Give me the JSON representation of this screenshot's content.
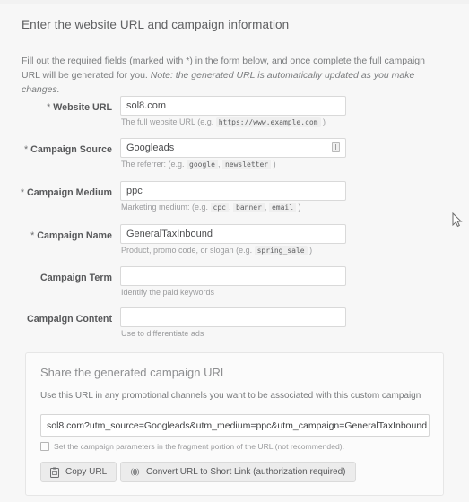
{
  "panel": {
    "heading": "Enter the website URL and campaign information",
    "intro_before": "Fill out the required fields (marked with *) in the form below, and once complete the full campaign URL will be generated for you. ",
    "intro_italic": "Note: the generated URL is automatically updated as you make changes."
  },
  "form": {
    "required_marker": "*",
    "fields": [
      {
        "label": "Website URL",
        "required": true,
        "value": "sol8.com",
        "placeholder": "",
        "hint_before": "The full website URL (e.g. ",
        "hint_code": "https://www.example.com",
        "hint_after": " )",
        "icon": ""
      },
      {
        "label": "Campaign Source",
        "required": true,
        "value": "Googleads",
        "placeholder": "",
        "hint_before": "The referrer: (e.g. ",
        "hint_code": "google",
        "hint_code2": "newsletter",
        "hint_after": " )",
        "icon": "autocomplete-icon"
      },
      {
        "label": "Campaign Medium",
        "required": true,
        "value": "ppc",
        "placeholder": "",
        "hint_before": "Marketing medium: (e.g. ",
        "hint_code": "cpc",
        "hint_code2": "banner",
        "hint_code3": "email",
        "hint_after": " )",
        "icon": ""
      },
      {
        "label": "Campaign Name",
        "required": true,
        "value": "GeneralTaxInbound",
        "placeholder": "",
        "hint_before": "Product, promo code, or slogan (e.g. ",
        "hint_code": "spring_sale",
        "hint_after": " )",
        "icon": ""
      },
      {
        "label": "Campaign Term",
        "required": false,
        "value": "",
        "placeholder": "",
        "hint_before": "Identify the paid keywords",
        "hint_code": "",
        "hint_after": "",
        "icon": ""
      },
      {
        "label": "Campaign Content",
        "required": false,
        "value": "",
        "placeholder": "",
        "hint_before": "Use to differentiate ads",
        "hint_code": "",
        "hint_after": "",
        "icon": ""
      }
    ]
  },
  "share": {
    "title": "Share the generated campaign URL",
    "subtitle": "Use this URL in any promotional channels you want to be associated with this custom campaign",
    "generated_url": "sol8.com?utm_source=Googleads&utm_medium=ppc&utm_campaign=GeneralTaxInbound",
    "fragment_checkbox_label": "Set the campaign parameters in the fragment portion of the URL (not recommended).",
    "fragment_checked": false,
    "copy_button": "Copy URL",
    "convert_button": "Convert URL to Short Link (authorization required)"
  },
  "colors": {
    "page_background": "#f7f7f7",
    "outer_background": "#e8e8e8",
    "panel_background": "#fbfbfb",
    "border": "#e6e6e6",
    "text_primary": "#58595b",
    "text_muted": "#9b9c9e",
    "input_background": "#ffffff"
  }
}
